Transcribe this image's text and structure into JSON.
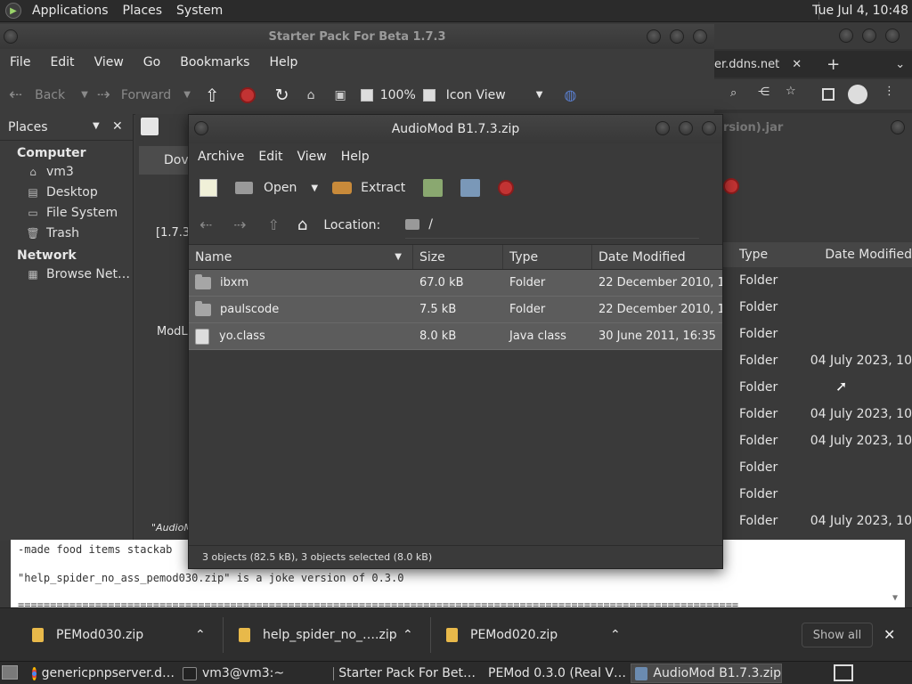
{
  "top_panel": {
    "menus": [
      "Applications",
      "Places",
      "System"
    ],
    "clock": "Tue Jul 4, 10:48"
  },
  "starter_window": {
    "title": "Starter Pack For Beta 1.7.3",
    "menus": [
      "File",
      "Edit",
      "View",
      "Go",
      "Bookmarks",
      "Help"
    ],
    "toolbar": {
      "back": "Back",
      "forward": "Forward",
      "zoom": "100%",
      "view_mode": "Icon View"
    },
    "sidebar": {
      "header": "Places",
      "sections": [
        {
          "title": "Computer",
          "items": [
            {
              "label": "vm3",
              "icon": "home-icon"
            },
            {
              "label": "Desktop",
              "icon": "desktop-icon"
            },
            {
              "label": "File System",
              "icon": "drive-icon"
            },
            {
              "label": "Trash",
              "icon": "trash-icon"
            }
          ]
        },
        {
          "title": "Network",
          "items": [
            {
              "label": "Browse Net…",
              "icon": "network-icon"
            }
          ]
        }
      ]
    },
    "main_fragments": {
      "tab_partial": "Dov",
      "version_partial": "[1.7.3]",
      "modl_partial": "ModL",
      "status_partial": "\"AudioMo"
    }
  },
  "browser": {
    "tab_partial": "er.ddns.net",
    "jar_partial": "rsion).jar"
  },
  "background_list": {
    "headers": {
      "type": "Type",
      "date": "Date Modified"
    },
    "rows": [
      {
        "type": "Folder",
        "date": ""
      },
      {
        "type": "Folder",
        "date": ""
      },
      {
        "type": "Folder",
        "date": ""
      },
      {
        "type": "Folder",
        "date": "04 July 2023, 10"
      },
      {
        "type": "Folder",
        "date": ""
      },
      {
        "type": "Folder",
        "date": "04 July 2023, 10"
      },
      {
        "type": "Folder",
        "date": "04 July 2023, 10"
      },
      {
        "type": "Folder",
        "date": ""
      },
      {
        "type": "Folder",
        "date": ""
      },
      {
        "type": "Folder",
        "date": "04 July 2023, 10"
      }
    ]
  },
  "editor": {
    "line1": "-made food items stackab",
    "line2": "\"help_spider_no_ass_pemod030.zip\" is a joke version of 0.3.0",
    "line3": "================================================================================================================"
  },
  "archive_window": {
    "title": "AudioMod B1.7.3.zip",
    "menus": [
      "Archive",
      "Edit",
      "View",
      "Help"
    ],
    "toolbar": {
      "open": "Open",
      "extract": "Extract"
    },
    "location_label": "Location:",
    "location_path": "/",
    "columns": {
      "name": "Name",
      "size": "Size",
      "type": "Type",
      "date": "Date Modified"
    },
    "rows": [
      {
        "name": "ibxm",
        "size": "67.0 kB",
        "type": "Folder",
        "date": "22 December 2010, 1…",
        "icon": "folder-icon"
      },
      {
        "name": "paulscode",
        "size": "7.5 kB",
        "type": "Folder",
        "date": "22 December 2010, 1…",
        "icon": "folder-icon"
      },
      {
        "name": "yo.class",
        "size": "8.0 kB",
        "type": "Java class",
        "date": "30 June 2011, 16:35",
        "icon": "java-file-icon"
      }
    ],
    "status": "3 objects (82.5 kB), 3 objects selected (8.0 kB)"
  },
  "downloads": {
    "items": [
      "PEMod030.zip",
      "help_spider_no_….zip",
      "PEMod020.zip"
    ],
    "show_all": "Show all"
  },
  "taskbar": {
    "tasks": [
      {
        "label": "genericpnpserver.d…",
        "icon": "chrome-icon"
      },
      {
        "label": "vm3@vm3:~",
        "icon": "terminal-icon"
      },
      {
        "label": "Starter Pack For Bet…",
        "icon": "folder-icon"
      },
      {
        "label": "PEMod 0.3.0 (Real V…",
        "icon": "archive-icon"
      },
      {
        "label": "AudioMod B1.7.3.zip",
        "icon": "archive-icon",
        "active": true
      }
    ]
  },
  "colors": {
    "stop_red": "#c23333",
    "folder_yellow": "#e8b94a",
    "row_selected": "#5c5c5c"
  }
}
